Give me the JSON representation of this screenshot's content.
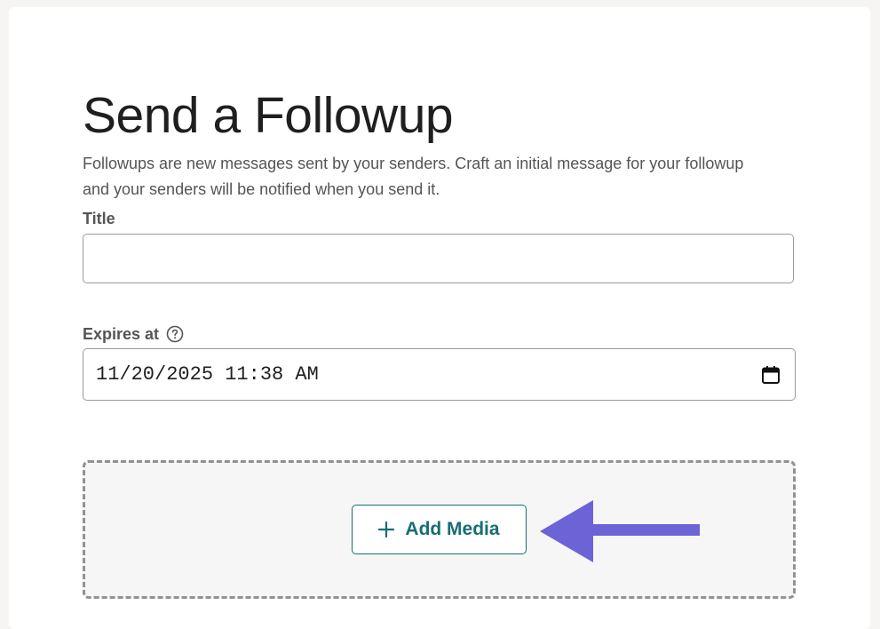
{
  "page": {
    "title": "Send a Followup",
    "description": "Followups are new messages sent by your senders. Craft an initial message for your followup and your senders will be notified when you send it."
  },
  "form": {
    "title_field": {
      "label": "Title",
      "value": ""
    },
    "expires_field": {
      "label": "Expires at",
      "value": "11/20/2025 11:38 AM",
      "help_icon": "question-circle-icon",
      "picker_icon": "calendar-icon"
    },
    "media": {
      "button_label": "Add Media",
      "button_icon": "plus-icon"
    }
  },
  "annotation": {
    "type": "arrow",
    "color": "#6b63d6",
    "points_to": "add-media-button"
  },
  "colors": {
    "accent": "#176e72",
    "annotation": "#6b63d6"
  }
}
